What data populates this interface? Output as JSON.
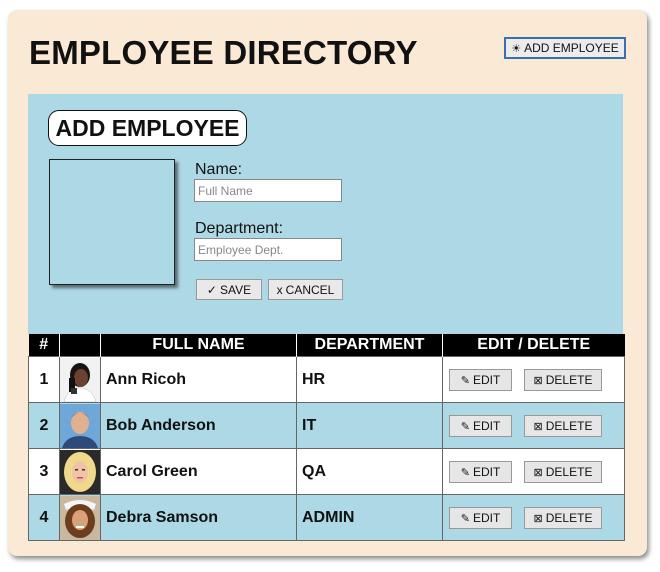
{
  "page": {
    "title": "EMPLOYEE DIRECTORY",
    "add_button": "ADD EMPLOYEE"
  },
  "form": {
    "title": "ADD EMPLOYEE",
    "name_label": "Name:",
    "name_placeholder": "Full Name",
    "dept_label": "Department:",
    "dept_placeholder": "Employee Dept.",
    "save_label": "SAVE",
    "cancel_label": "CANCEL"
  },
  "table": {
    "headers": [
      "#",
      "",
      "FULL NAME",
      "DEPARTMENT",
      "EDIT / DELETE"
    ],
    "edit_label": "EDIT",
    "delete_label": "DELETE",
    "rows": [
      {
        "num": "1",
        "name": "Ann Ricoh",
        "dept": "HR"
      },
      {
        "num": "2",
        "name": "Bob Anderson",
        "dept": "IT"
      },
      {
        "num": "3",
        "name": "Carol Green",
        "dept": "QA"
      },
      {
        "num": "4",
        "name": "Debra Samson",
        "dept": "ADMIN"
      }
    ]
  },
  "icons": {
    "add": "sun-icon",
    "save": "checkmark-icon",
    "cancel": "x-icon",
    "edit": "pencil-icon",
    "delete": "delete-box-icon"
  },
  "colors": {
    "card_background": "#f9e9d5",
    "panel_blue": "#add8e6",
    "header_black": "#000000",
    "button_border_blue": "#3a6fb0"
  }
}
